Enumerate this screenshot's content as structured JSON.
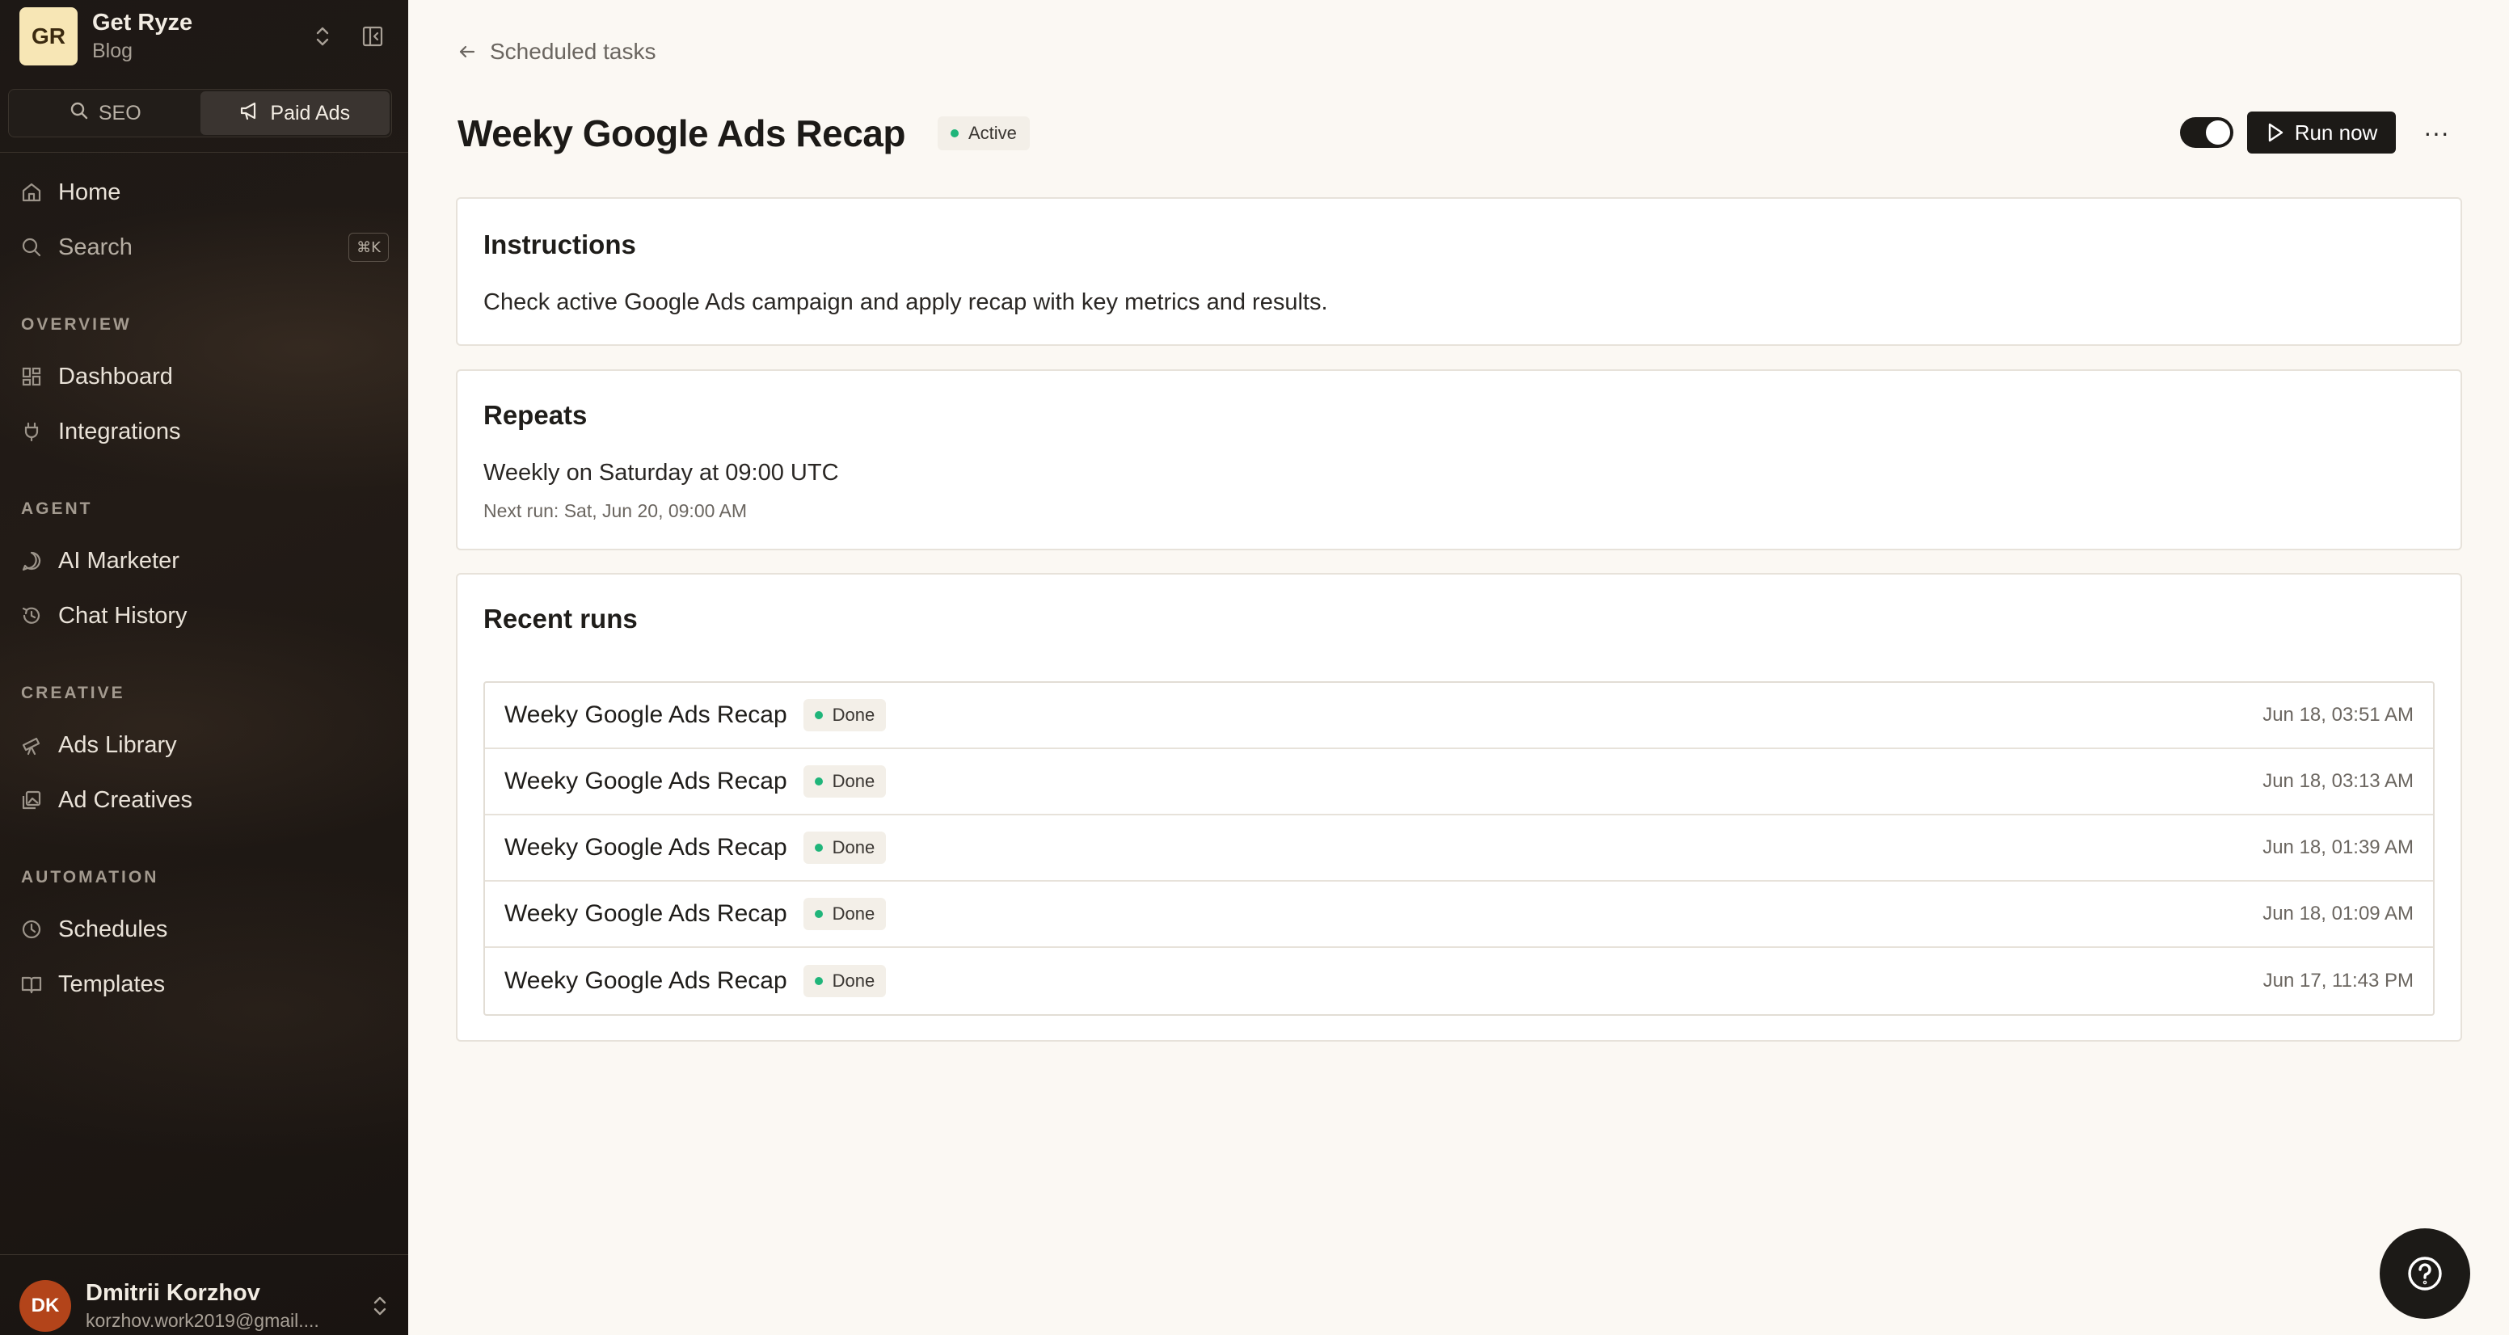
{
  "workspace": {
    "initials": "GR",
    "name": "Get Ryze",
    "sub": "Blog"
  },
  "modes": [
    {
      "label": "SEO",
      "icon": "search-icon",
      "active": false
    },
    {
      "label": "Paid Ads",
      "icon": "megaphone-icon",
      "active": true
    }
  ],
  "nav_top": [
    {
      "label": "Home",
      "icon": "home-icon"
    },
    {
      "label": "Search",
      "icon": "search-icon",
      "shortcut": "⌘K"
    }
  ],
  "sections": [
    {
      "title": "OVERVIEW",
      "items": [
        {
          "label": "Dashboard",
          "icon": "grid-icon"
        },
        {
          "label": "Integrations",
          "icon": "plug-icon"
        }
      ]
    },
    {
      "title": "AGENT",
      "items": [
        {
          "label": "AI Marketer",
          "icon": "chat-bubble-icon"
        },
        {
          "label": "Chat History",
          "icon": "history-icon"
        }
      ]
    },
    {
      "title": "CREATIVE",
      "items": [
        {
          "label": "Ads Library",
          "icon": "telescope-icon"
        },
        {
          "label": "Ad Creatives",
          "icon": "images-icon"
        }
      ]
    },
    {
      "title": "AUTOMATION",
      "items": [
        {
          "label": "Schedules",
          "icon": "clock-icon"
        },
        {
          "label": "Templates",
          "icon": "book-icon"
        }
      ]
    }
  ],
  "user": {
    "initials": "DK",
    "name": "Dmitrii Korzhov",
    "email": "korzhov.work2019@gmail...."
  },
  "breadcrumb": {
    "label": "Scheduled tasks"
  },
  "task": {
    "title": "Weeky Google Ads Recap",
    "status": "Active",
    "enabled": true,
    "run_label": "Run now",
    "more": "···"
  },
  "instructions": {
    "title": "Instructions",
    "text": "Check active Google Ads campaign and apply recap with key metrics and results."
  },
  "repeats": {
    "title": "Repeats",
    "schedule": "Weekly on Saturday at 09:00 UTC",
    "next_run": "Next run: Sat, Jun 20, 09:00 AM"
  },
  "recent_runs": {
    "title": "Recent runs",
    "rows": [
      {
        "name": "Weeky Google Ads Recap",
        "status": "Done",
        "time": "Jun 18, 03:51 AM"
      },
      {
        "name": "Weeky Google Ads Recap",
        "status": "Done",
        "time": "Jun 18, 03:13 AM"
      },
      {
        "name": "Weeky Google Ads Recap",
        "status": "Done",
        "time": "Jun 18, 01:39 AM"
      },
      {
        "name": "Weeky Google Ads Recap",
        "status": "Done",
        "time": "Jun 18, 01:09 AM"
      },
      {
        "name": "Weeky Google Ads Recap",
        "status": "Done",
        "time": "Jun 17, 11:43 PM"
      }
    ]
  },
  "colors": {
    "accent": "#1c1a17",
    "status_green": "#1fb57a",
    "avatar": "#b3441a",
    "workspace_badge": "#f7e6b5"
  }
}
